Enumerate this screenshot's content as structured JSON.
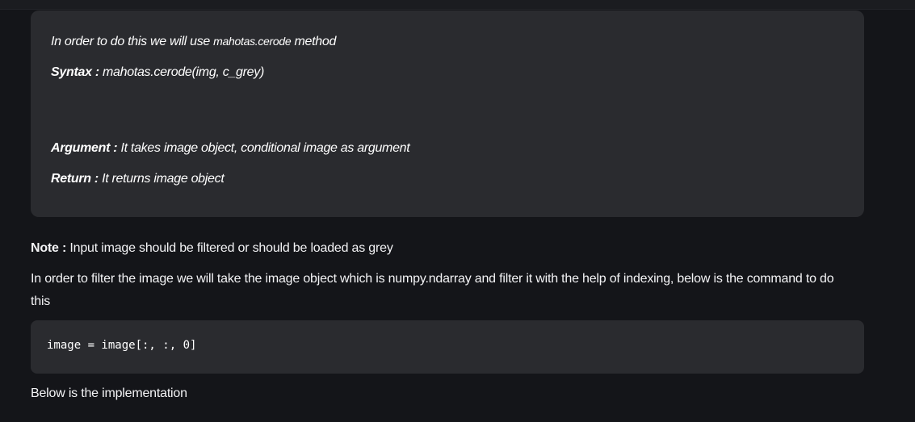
{
  "quote": {
    "line1_prefix": "In order to do this we will use ",
    "line1_method": "mahotas.cerode",
    "line1_suffix": " method",
    "syntax_label": "Syntax :",
    "syntax_value": " mahotas.cerode(img, c_grey)",
    "argument_label": "Argument :",
    "argument_value": " It takes image object, conditional image as argument",
    "return_label": "Return :",
    "return_value": " It returns image object"
  },
  "note": {
    "label": "Note :",
    "text": " Input image should be filtered or should be loaded as grey"
  },
  "filter_paragraph": "In order to filter the image we will take the image object which is numpy.ndarray and filter it with the help of indexing, below is the command to do this",
  "code": "image = image[:, :, 0]",
  "implementation_text": "Below is the implementation"
}
